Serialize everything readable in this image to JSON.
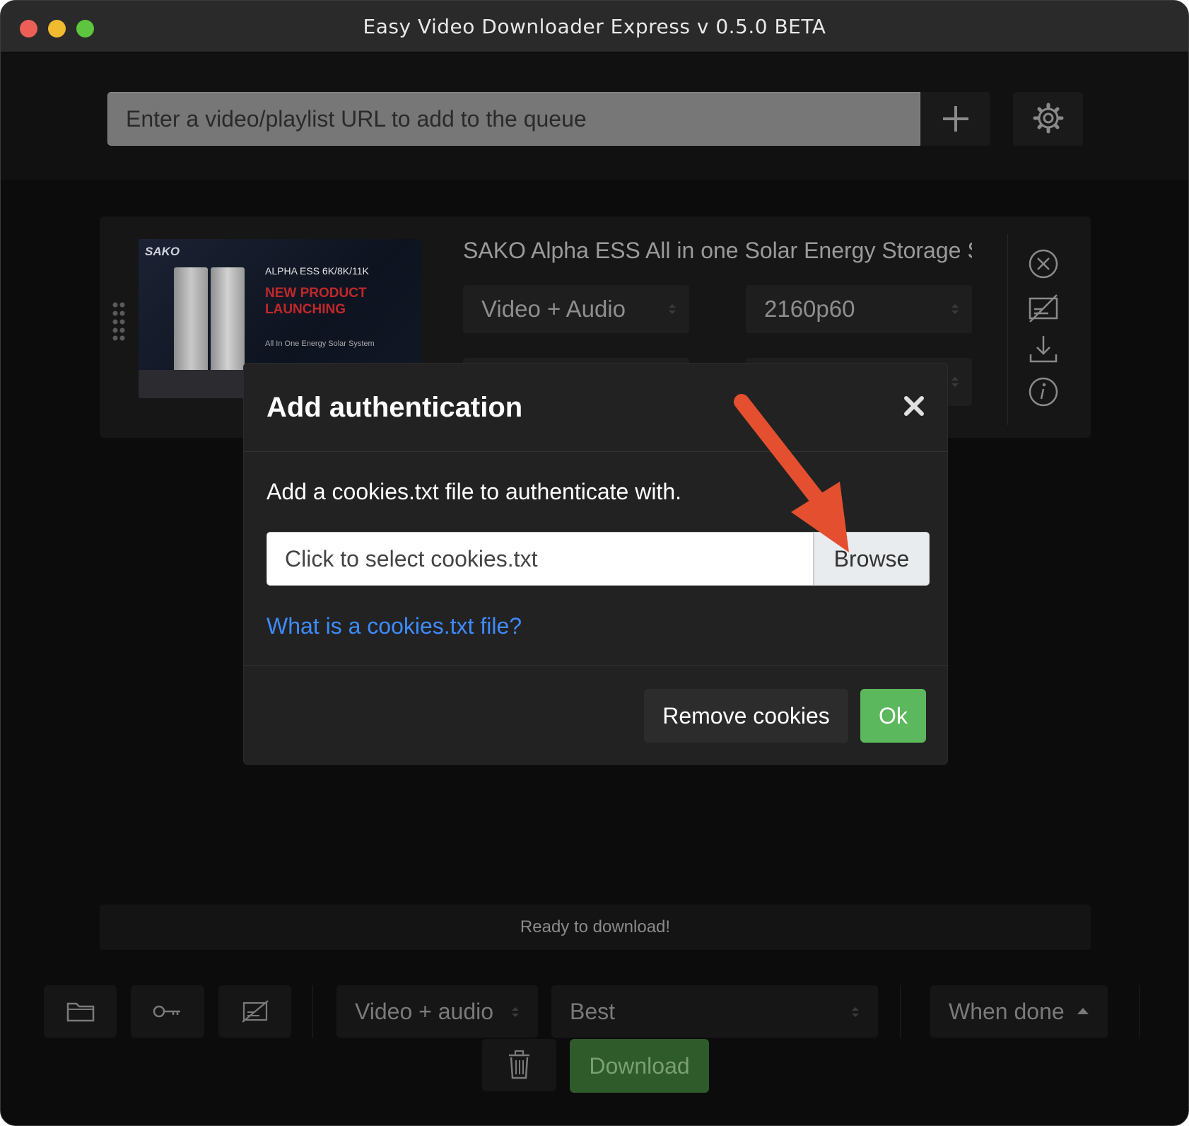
{
  "window": {
    "title": "Easy Video Downloader Express v 0.5.0 BETA"
  },
  "toolbar": {
    "url_placeholder": "Enter a video/playlist URL to add to the queue",
    "add_icon": "plus-icon",
    "settings_icon": "gear-icon"
  },
  "queue": {
    "items": [
      {
        "title": "SAKO Alpha ESS All in one Solar Energy Storage S",
        "type": "Video + Audio",
        "resolution": "2160p60",
        "thumbnail": {
          "brand": "SAKO",
          "line1": "ALPHA ESS 6K/8K/11K",
          "line2": "NEW PRODUCT LAUNCHING",
          "line3": "All In One Energy Solar System"
        },
        "icons": [
          "remove-circle-icon",
          "subtitles-off-icon",
          "download-icon",
          "info-icon"
        ]
      }
    ]
  },
  "status": {
    "text": "Ready to download!"
  },
  "bottom": {
    "type_select": "Video + audio",
    "quality_select": "Best",
    "when_done": "When done",
    "download_label": "Download"
  },
  "modal": {
    "title": "Add authentication",
    "description": "Add a cookies.txt file to authenticate with.",
    "file_placeholder": "Click to select cookies.txt",
    "browse_label": "Browse",
    "help_link": "What is a cookies.txt file?",
    "remove_label": "Remove cookies",
    "ok_label": "Ok"
  },
  "colors": {
    "ok_green": "#5cb85c",
    "link_blue": "#3d8bfd",
    "download_green": "#2f5a2a",
    "annotation_arrow": "#e4502f"
  }
}
